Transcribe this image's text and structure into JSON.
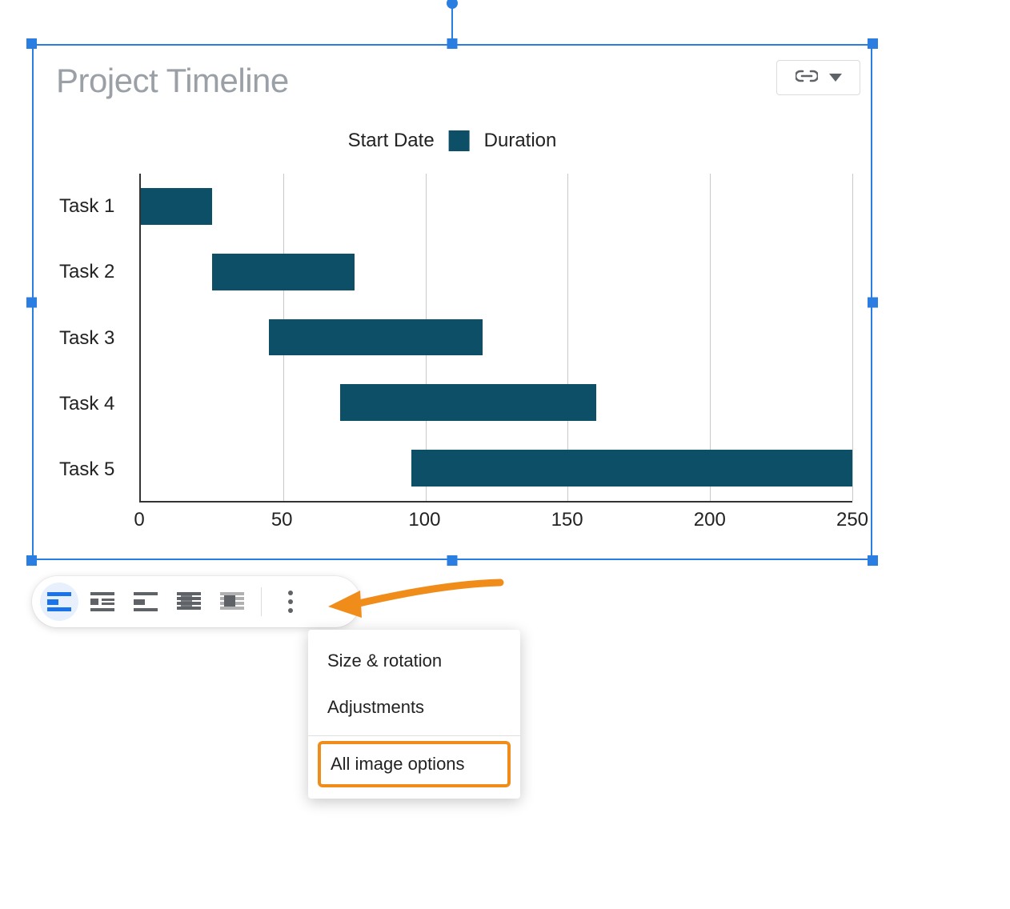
{
  "chart_data": {
    "type": "bar",
    "orientation": "horizontal-stacked-offset",
    "title": "Project Timeline",
    "legend": [
      "Start Date",
      "Duration"
    ],
    "categories": [
      "Task 1",
      "Task 2",
      "Task 3",
      "Task 4",
      "Task 5"
    ],
    "series": [
      {
        "name": "Start Date",
        "values": [
          0,
          25,
          45,
          70,
          95
        ],
        "fill": "transparent"
      },
      {
        "name": "Duration",
        "values": [
          25,
          50,
          75,
          90,
          155
        ],
        "fill": "#0d4f66"
      }
    ],
    "xlim": [
      0,
      250
    ],
    "xticks": [
      0,
      50,
      100,
      150,
      200,
      250
    ],
    "xlabel": "",
    "ylabel": ""
  },
  "toolbar": {
    "wrap_options": [
      {
        "name": "wrap-inline",
        "active": true
      },
      {
        "name": "wrap-square",
        "active": false
      },
      {
        "name": "wrap-break",
        "active": false
      },
      {
        "name": "wrap-behind",
        "active": false
      },
      {
        "name": "wrap-front",
        "active": false
      }
    ],
    "more_label": "More"
  },
  "menu": {
    "items": [
      {
        "label": "Size & rotation",
        "highlighted": false
      },
      {
        "label": "Adjustments",
        "highlighted": false
      }
    ],
    "all_options_label": "All image options"
  },
  "chart_controls": {
    "linked_chart": true
  }
}
